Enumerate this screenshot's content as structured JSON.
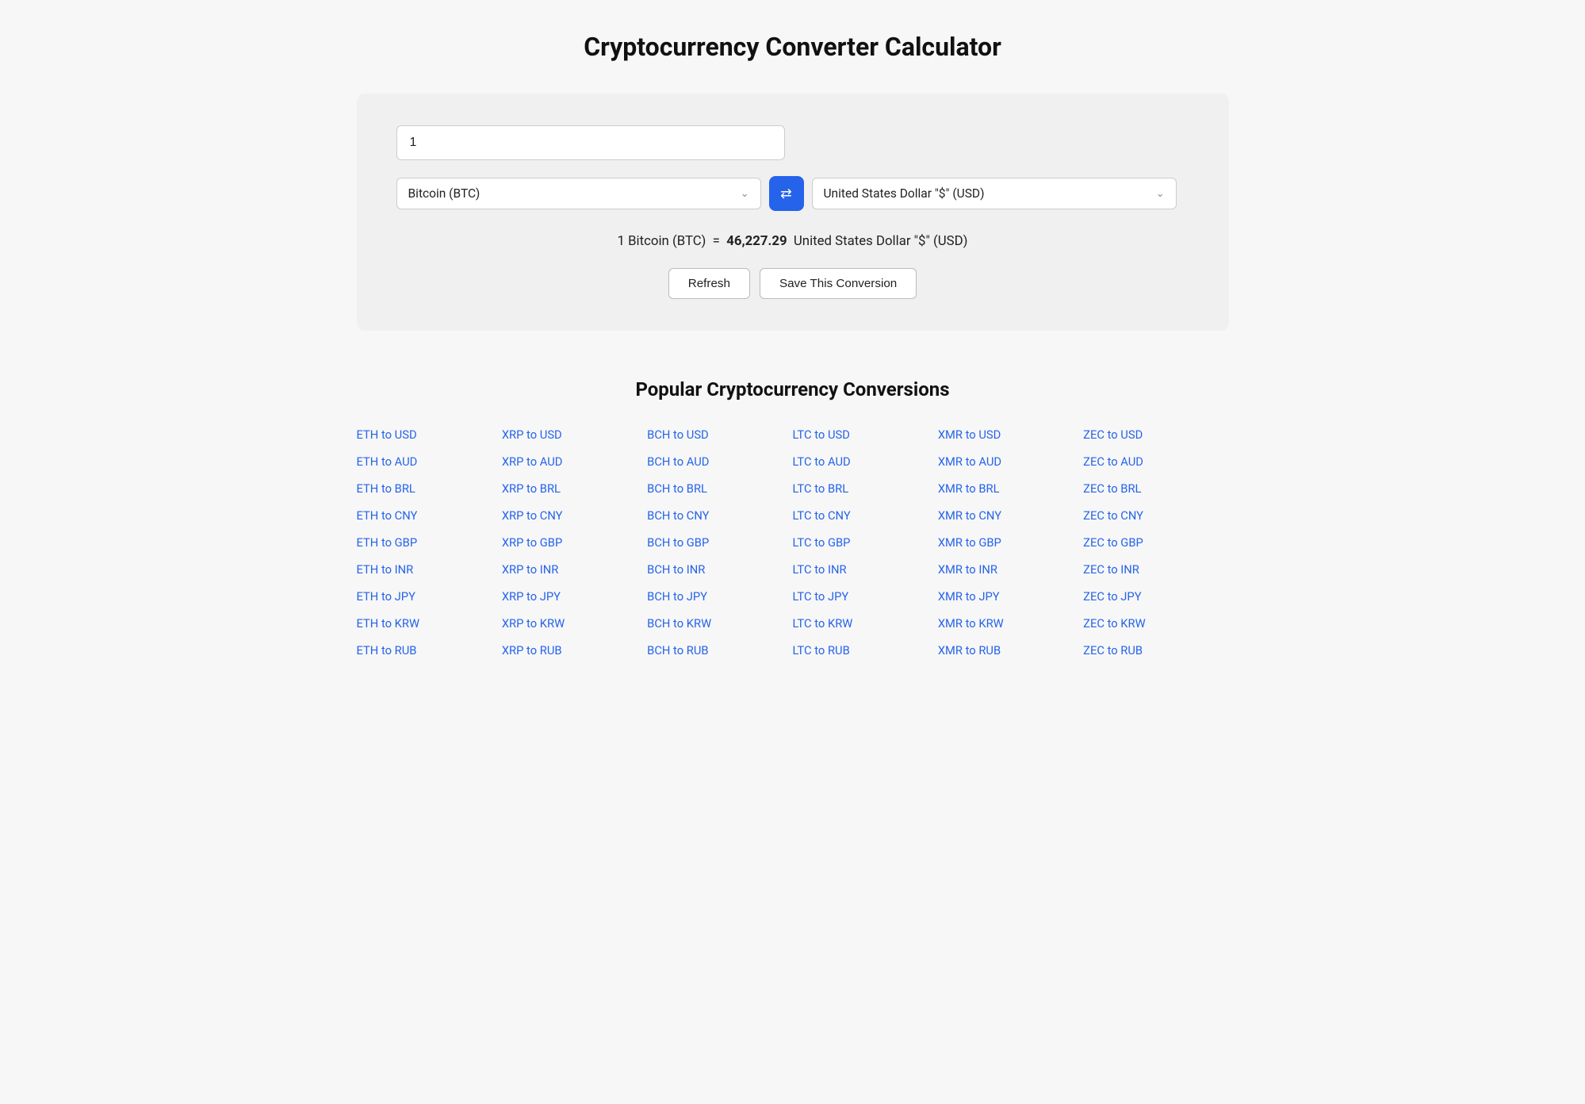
{
  "page": {
    "title": "Cryptocurrency Converter Calculator"
  },
  "converter": {
    "amount_value": "1",
    "from_currency": "Bitcoin (BTC)",
    "to_currency": "United States Dollar \"$\" (USD)",
    "result_text": "1 Bitcoin (BTC)",
    "result_equals": "=",
    "result_value": "46,227.29",
    "result_unit": "United States Dollar \"$\" (USD)",
    "refresh_label": "Refresh",
    "save_label": "Save This Conversion",
    "swap_icon": "⇄"
  },
  "popular": {
    "title": "Popular Cryptocurrency Conversions",
    "columns": [
      {
        "links": [
          "ETH to USD",
          "ETH to AUD",
          "ETH to BRL",
          "ETH to CNY",
          "ETH to GBP",
          "ETH to INR",
          "ETH to JPY",
          "ETH to KRW",
          "ETH to RUB"
        ]
      },
      {
        "links": [
          "XRP to USD",
          "XRP to AUD",
          "XRP to BRL",
          "XRP to CNY",
          "XRP to GBP",
          "XRP to INR",
          "XRP to JPY",
          "XRP to KRW",
          "XRP to RUB"
        ]
      },
      {
        "links": [
          "BCH to USD",
          "BCH to AUD",
          "BCH to BRL",
          "BCH to CNY",
          "BCH to GBP",
          "BCH to INR",
          "BCH to JPY",
          "BCH to KRW",
          "BCH to RUB"
        ]
      },
      {
        "links": [
          "LTC to USD",
          "LTC to AUD",
          "LTC to BRL",
          "LTC to CNY",
          "LTC to GBP",
          "LTC to INR",
          "LTC to JPY",
          "LTC to KRW",
          "LTC to RUB"
        ]
      },
      {
        "links": [
          "XMR to USD",
          "XMR to AUD",
          "XMR to BRL",
          "XMR to CNY",
          "XMR to GBP",
          "XMR to INR",
          "XMR to JPY",
          "XMR to KRW",
          "XMR to RUB"
        ]
      },
      {
        "links": [
          "ZEC to USD",
          "ZEC to AUD",
          "ZEC to BRL",
          "ZEC to CNY",
          "ZEC to GBP",
          "ZEC to INR",
          "ZEC to JPY",
          "ZEC to KRW",
          "ZEC to RUB"
        ]
      }
    ]
  }
}
